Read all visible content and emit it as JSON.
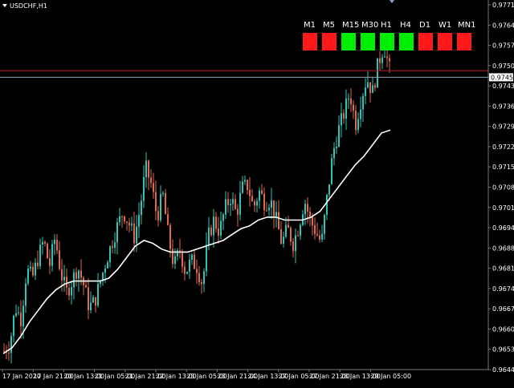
{
  "window": {
    "title": "USDCHF,H1"
  },
  "timeframes": [
    {
      "label": "M1",
      "state": "down"
    },
    {
      "label": "M5",
      "state": "down"
    },
    {
      "label": "M15",
      "state": "up"
    },
    {
      "label": "M30",
      "state": "up"
    },
    {
      "label": "H1",
      "state": "up"
    },
    {
      "label": "H4",
      "state": "up"
    },
    {
      "label": "D1",
      "state": "down"
    },
    {
      "label": "W1",
      "state": "down"
    },
    {
      "label": "MN1",
      "state": "down"
    }
  ],
  "colors": {
    "background": "#000000",
    "bull": "#2ec4b6",
    "bear": "#e0684b",
    "ma": "#ffffff",
    "bid_line": "#c0202a",
    "ask_line": "#8fa3b8",
    "up": "#00ee00",
    "down": "#ff1a1a",
    "grid": "#7a7a7a"
  },
  "chart_data": {
    "type": "candlestick",
    "symbol": "USDCHF",
    "timeframe": "H1",
    "ylim": [
      0.96445,
      0.9771
    ],
    "y_ticks": [
      "0.97710",
      "0.97640",
      "0.97575",
      "0.97505",
      "0.97435",
      "0.97365",
      "0.97295",
      "0.97225",
      "0.97155",
      "0.97085",
      "0.97015",
      "0.96945",
      "0.96880",
      "0.96810",
      "0.96740",
      "0.96670",
      "0.96600",
      "0.96530",
      "0.96445"
    ],
    "price_marker": "0.97452",
    "bid_price": 0.97475,
    "ask_price": 0.97452,
    "x_ticks": [
      "17 Jan 2020",
      "17 Jan 21:00",
      "20 Jan 13:00",
      "21 Jan 05:00",
      "21 Jan 21:00",
      "22 Jan 13:00",
      "23 Jan 05:00",
      "23 Jan 21:00",
      "24 Jan 13:00",
      "27 Jan 05:00",
      "27 Jan 21:00",
      "28 Jan 13:00",
      "29 Jan 05:00"
    ],
    "close_path": [
      0.9651,
      0.9653,
      0.9666,
      0.9662,
      0.9679,
      0.9676,
      0.9683,
      0.9689,
      0.968,
      0.969,
      0.9678,
      0.9671,
      0.9675,
      0.968,
      0.9674,
      0.9666,
      0.9668,
      0.9675,
      0.9682,
      0.9688,
      0.9694,
      0.9699,
      0.9695,
      0.969,
      0.97,
      0.9714,
      0.9708,
      0.9697,
      0.9705,
      0.969,
      0.968,
      0.9686,
      0.9678,
      0.9682,
      0.968,
      0.9674,
      0.969,
      0.9696,
      0.9692,
      0.97,
      0.9704,
      0.9698,
      0.9707,
      0.9708,
      0.97,
      0.9706,
      0.9702,
      0.9703,
      0.9696,
      0.9688,
      0.9693,
      0.9688,
      0.9694,
      0.9703,
      0.9696,
      0.9692,
      0.9688,
      0.9704,
      0.9719,
      0.9727,
      0.9733,
      0.974,
      0.9729,
      0.9738,
      0.9745,
      0.974,
      0.975,
      0.9756,
      0.9748
    ],
    "ma_path": [
      0.965,
      0.9652,
      0.9656,
      0.9661,
      0.9665,
      0.9669,
      0.9672,
      0.9674,
      0.9675,
      0.9675,
      0.9675,
      0.9675,
      0.9676,
      0.9679,
      0.9683,
      0.9687,
      0.9689,
      0.9688,
      0.9686,
      0.9685,
      0.9685,
      0.9685,
      0.9686,
      0.9687,
      0.9688,
      0.9689,
      0.9691,
      0.9693,
      0.9694,
      0.9696,
      0.9697,
      0.9697,
      0.9696,
      0.9696,
      0.9696,
      0.9697,
      0.9699,
      0.9703,
      0.9707,
      0.9711,
      0.9715,
      0.9718,
      0.9722,
      0.9726,
      0.9727
    ],
    "ma_period_label": ""
  }
}
